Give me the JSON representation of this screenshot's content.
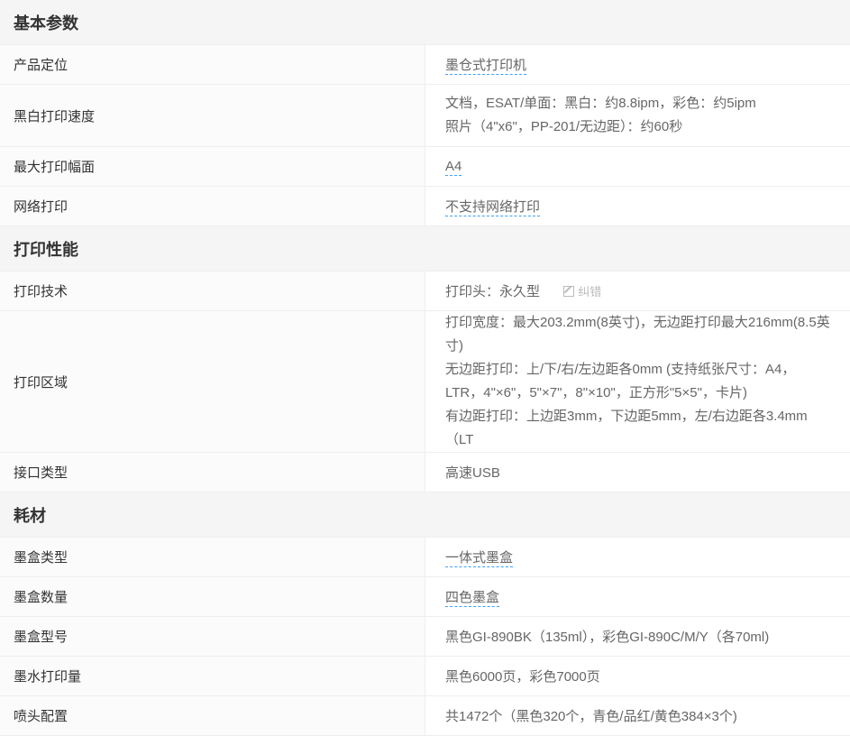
{
  "sections": [
    {
      "title": "基本参数",
      "rows": [
        {
          "label": "产品定位",
          "lines": [
            "墨仓式打印机"
          ],
          "link": true
        },
        {
          "label": "黑白打印速度",
          "lines": [
            "文档，ESAT/单面：黑白：约8.8ipm，彩色：约5ipm",
            "照片（4\"x6\"，PP-201/无边距）：约60秒"
          ]
        },
        {
          "label": "最大打印幅面",
          "lines": [
            "A4"
          ],
          "link": true
        },
        {
          "label": "网络打印",
          "lines": [
            "不支持网络打印"
          ],
          "link": true
        }
      ]
    },
    {
      "title": "打印性能",
      "rows": [
        {
          "label": "打印技术",
          "lines": [
            "打印头：永久型"
          ],
          "correct": "纠错"
        },
        {
          "label": "打印区域",
          "lines": [
            "打印宽度：最大203.2mm(8英寸)，无边距打印最大216mm(8.5英寸)",
            "无边距打印：上/下/右/左边距各0mm (支持纸张尺寸：A4，LTR，4\"×6\"，5\"×7\"，8\"×10\"，正方形\"5×5\"，卡片)",
            "有边距打印：上边距3mm，下边距5mm，左/右边距各3.4mm（LT"
          ]
        },
        {
          "label": "接口类型",
          "lines": [
            "高速USB"
          ]
        }
      ]
    },
    {
      "title": "耗材",
      "rows": [
        {
          "label": "墨盒类型",
          "lines": [
            "一体式墨盒"
          ],
          "link": true
        },
        {
          "label": "墨盒数量",
          "lines": [
            "四色墨盒"
          ],
          "link": true
        },
        {
          "label": "墨盒型号",
          "lines": [
            "黑色GI-890BK（135ml），彩色GI-890C/M/Y（各70ml)"
          ]
        },
        {
          "label": "墨水打印量",
          "lines": [
            "黑色6000页，彩色7000页"
          ]
        },
        {
          "label": "喷头配置",
          "lines": [
            "共1472个（黑色320个，青色/品红/黄色384×3个)"
          ]
        }
      ]
    }
  ]
}
